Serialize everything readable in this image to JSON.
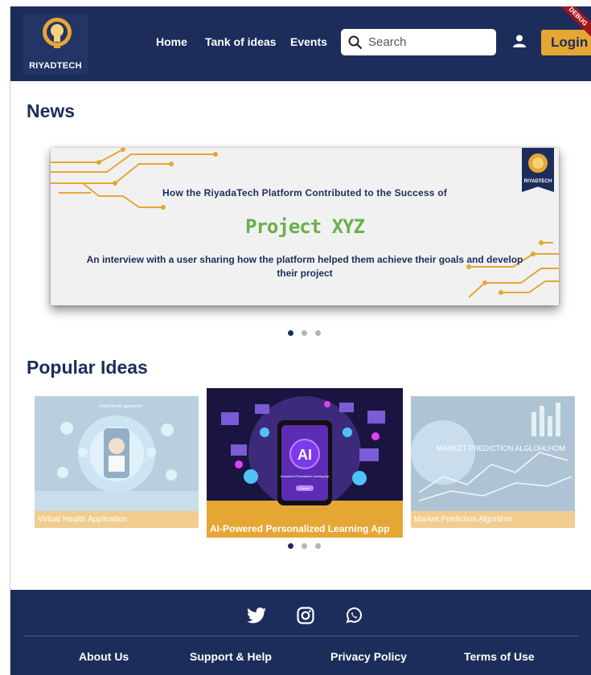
{
  "header": {
    "logo_text": "RIYADTECH",
    "nav": [
      "Home",
      "Tank of ideas",
      "Events"
    ],
    "search_placeholder": "Search",
    "login_label": "Login",
    "debug_label": "DEBUG"
  },
  "news": {
    "title": "News",
    "banner": {
      "badge_text": "RIYADTECH",
      "headline": "How the RiyadaTech Platform Contributed to the Success of",
      "project": "Project XYZ",
      "subtext": "An interview with a user sharing how the platform helped them achieve their goals and develop their project"
    },
    "carousel_active": 0,
    "carousel_count": 3
  },
  "popular": {
    "title": "Popular Ideas",
    "cards": [
      {
        "caption": "Virtual Health Application",
        "screen_title": "Virtual health application"
      },
      {
        "caption": "AI-Powered Personalized Learning App",
        "screen_title": "AI",
        "screen_sub": "AI-powered Personalized Learning App",
        "screen_btn": "Explore"
      },
      {
        "caption": "Market Prediction Algorithm",
        "screen_title": "MARKET PREDICTION ALGLOHLHOM"
      }
    ],
    "carousel_active": 0
  },
  "footer": {
    "social": [
      "twitter-icon",
      "instagram-icon",
      "whatsapp-icon"
    ],
    "links": [
      "About Us",
      "Support & Help",
      "Privacy Policy",
      "Terms of Use"
    ]
  },
  "colors": {
    "navy": "#1d2d5b",
    "gold": "#e6a634",
    "green": "#6ab04c"
  }
}
